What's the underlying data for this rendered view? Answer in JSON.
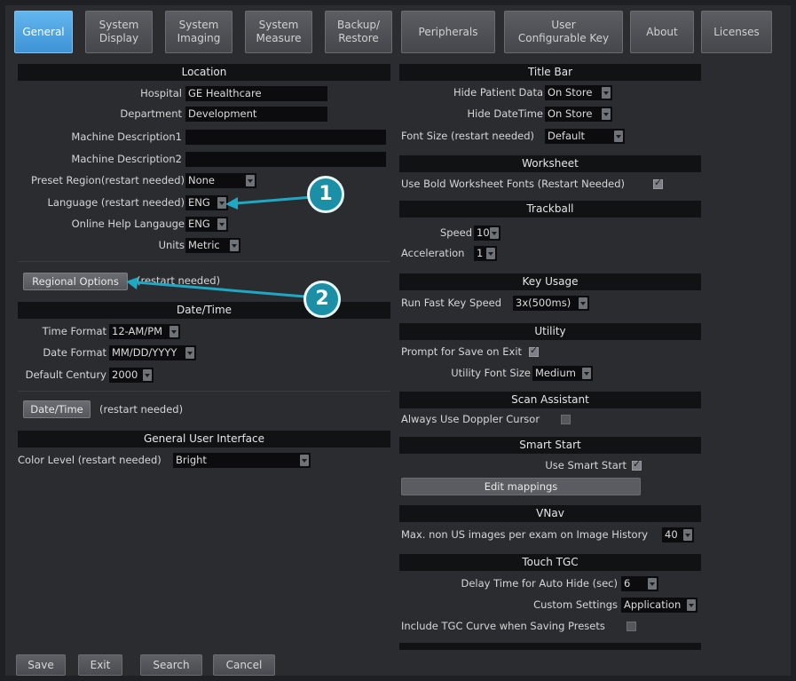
{
  "tabs": [
    {
      "line1": "General",
      "line2": ""
    },
    {
      "line1": "System",
      "line2": "Display"
    },
    {
      "line1": "System",
      "line2": "Imaging"
    },
    {
      "line1": "System",
      "line2": "Measure"
    },
    {
      "line1": "Backup/",
      "line2": "Restore"
    },
    {
      "line1": "Peripherals",
      "line2": ""
    },
    {
      "line1": "User",
      "line2": "Configurable Key"
    },
    {
      "line1": "About",
      "line2": ""
    },
    {
      "line1": "Licenses",
      "line2": ""
    }
  ],
  "location": {
    "title": "Location",
    "hospital_label": "Hospital",
    "hospital_value": "GE Healthcare",
    "department_label": "Department",
    "department_value": "Development",
    "machine1_label": "Machine Description1",
    "machine1_value": "",
    "machine2_label": "Machine Description2",
    "machine2_value": "",
    "preset_label": "Preset Region(restart needed)",
    "preset_value": "None",
    "language_label": "Language (restart needed)",
    "language_value": "ENG",
    "help_label": "Online Help Langauge",
    "help_value": "ENG",
    "units_label": "Units",
    "units_value": "Metric"
  },
  "regional": {
    "button": "Regional Options",
    "note": "(restart needed)"
  },
  "datetime": {
    "title": "Date/Time",
    "time_label": "Time Format",
    "time_value": "12-AM/PM",
    "date_label": "Date Format",
    "date_value": "MM/DD/YYYY",
    "century_label": "Default Century",
    "century_value": "2000",
    "button": "Date/Time",
    "note": "(restart needed)"
  },
  "gui": {
    "title": "General User Interface",
    "color_label": "Color Level (restart needed)",
    "color_value": "Bright"
  },
  "titlebar": {
    "title": "Title Bar",
    "hide_patient_label": "Hide Patient Data",
    "hide_patient_value": "On Store",
    "hide_datetime_label": "Hide DateTime",
    "hide_datetime_value": "On Store",
    "font_label": "Font Size (restart needed)",
    "font_value": "Default"
  },
  "worksheet": {
    "title": "Worksheet",
    "bold_label": "Use Bold Worksheet Fonts (Restart Needed)"
  },
  "trackball": {
    "title": "Trackball",
    "speed_label": "Speed",
    "speed_value": "10",
    "accel_label": "Acceleration",
    "accel_value": "1"
  },
  "keyusage": {
    "title": "Key Usage",
    "fast_label": "Run Fast Key Speed",
    "fast_value": "3x(500ms)"
  },
  "utility": {
    "title": "Utility",
    "prompt_label": "Prompt for Save on Exit",
    "font_label": "Utility Font Size",
    "font_value": "Medium"
  },
  "scan": {
    "title": "Scan Assistant",
    "doppler_label": "Always Use Doppler Cursor"
  },
  "smart": {
    "title": "Smart Start",
    "use_label": "Use Smart Start",
    "edit_button": "Edit mappings"
  },
  "vnav": {
    "title": "VNav",
    "max_label": "Max. non US images per exam on Image History",
    "max_value": "40"
  },
  "tgc": {
    "title": "Touch TGC",
    "delay_label": "Delay Time for Auto Hide (sec)",
    "delay_value": "6",
    "custom_label": "Custom Settings",
    "custom_value": "Application",
    "include_label": "Include TGC Curve when Saving Presets"
  },
  "callouts": [
    "1",
    "2"
  ],
  "bottom": {
    "save": "Save",
    "exit": "Exit",
    "search": "Search",
    "cancel": "Cancel"
  },
  "colors": {
    "accent": "#3e93d6",
    "callout": "#1b8fa5",
    "panel": "#2b2c30",
    "header": "#111214"
  }
}
